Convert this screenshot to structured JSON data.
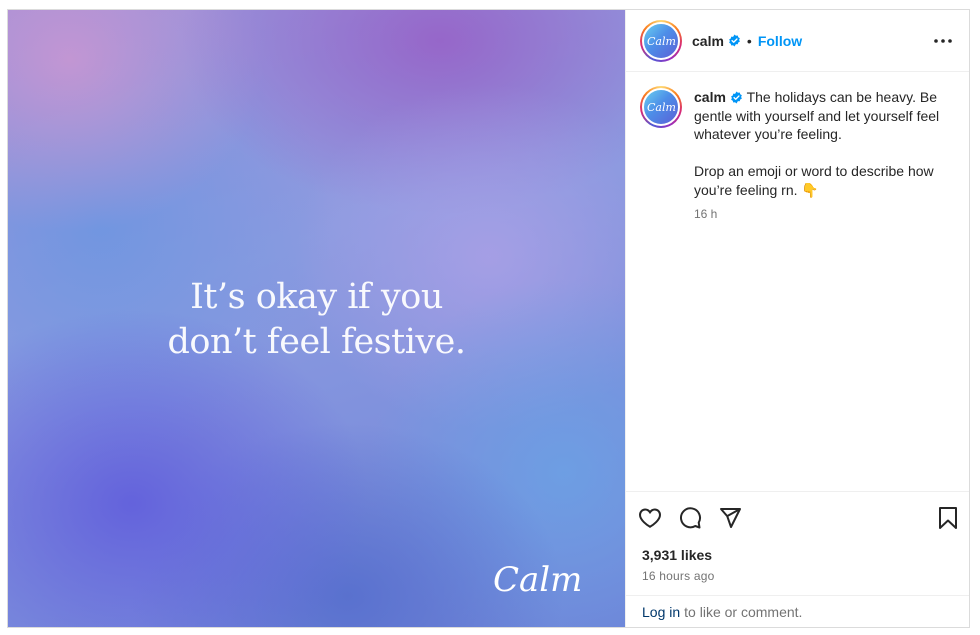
{
  "post": {
    "media": {
      "line1": "It’s okay if you",
      "line2": "don’t feel festive.",
      "logo_text": "Calm"
    },
    "header": {
      "username": "calm",
      "separator": "•",
      "follow_label": "Follow",
      "more_icon": "more-horizontal-icon"
    },
    "caption": {
      "username": "calm",
      "text": "The holidays can be heavy. Be gentle with yourself and let yourself feel whatever you’re feeling.\n\nDrop an emoji or word to describe how you’re feeling rn. 👇",
      "time": "16 h"
    },
    "actions": {
      "icons": [
        "heart-icon",
        "comment-icon",
        "share-icon",
        "bookmark-icon"
      ]
    },
    "likes": "3,931 likes",
    "posted_ago": "16 hours ago",
    "login": {
      "link": "Log in",
      "rest": "to like or comment."
    },
    "colors": {
      "accent": "#0095f6",
      "verified": "#0095f6",
      "link": "#00376b",
      "muted": "#737373"
    }
  }
}
